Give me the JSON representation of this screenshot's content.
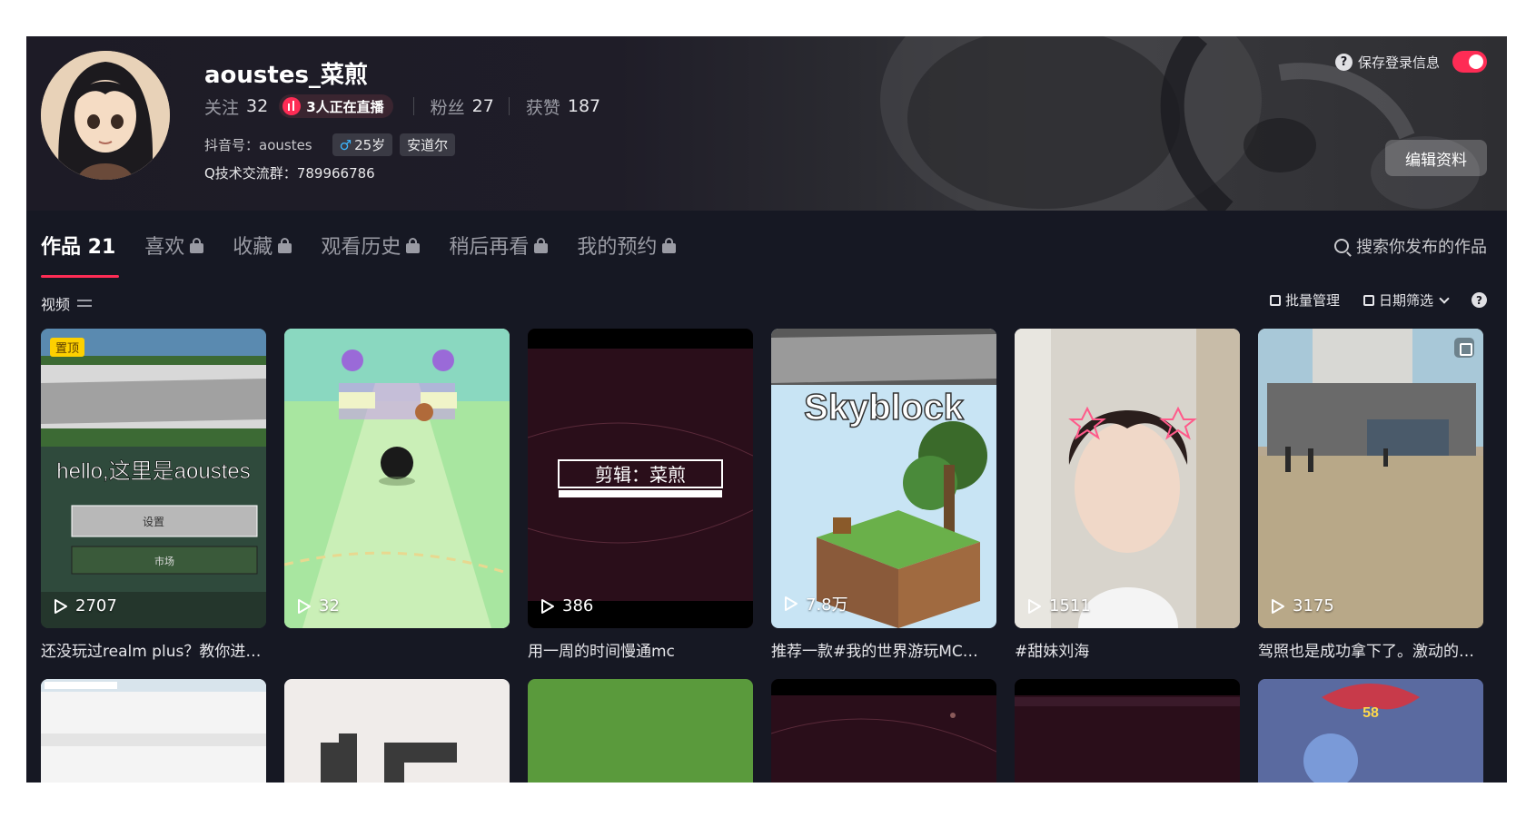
{
  "profile": {
    "username": "aoustes_菜煎",
    "following_label": "关注",
    "following": "32",
    "live_badge": "3人正在直播",
    "followers_label": "粉丝",
    "followers": "27",
    "likes_label": "获赞",
    "likes": "187",
    "douyin_id": "抖音号：aoustes",
    "gender_icon": "♂",
    "age": "25岁",
    "location": "安道尔",
    "qq_group": "Q技术交流群：789966786",
    "save_login": "保存登录信息",
    "edit_button": "编辑资料"
  },
  "tabs": [
    {
      "label": "作品 21",
      "locked": false
    },
    {
      "label": "喜欢",
      "locked": true
    },
    {
      "label": "收藏",
      "locked": true
    },
    {
      "label": "观看历史",
      "locked": true
    },
    {
      "label": "稍后再看",
      "locked": true
    },
    {
      "label": "我的预约",
      "locked": true
    }
  ],
  "search_placeholder": "搜索你发布的作品",
  "filter": {
    "section_label": "视频",
    "batch_manage": "批量管理",
    "date_filter": "日期筛选"
  },
  "videos": [
    {
      "plays": "2707",
      "caption": "还没玩过realm plus？教你进…",
      "pinned_label": "置顶",
      "thumb_text": "hello,这里是aoustes",
      "thumb_btn1": "设置",
      "thumb_btn2": "市场"
    },
    {
      "plays": "32",
      "caption": ""
    },
    {
      "plays": "386",
      "caption": "用一周的时间慢通mc",
      "thumb_text": "剪辑：菜煎"
    },
    {
      "plays": "7.8万",
      "caption": "推荐一款#我的世界游玩MC…",
      "thumb_text": "Skyblock"
    },
    {
      "plays": "1511",
      "caption": "#甜妹刘海"
    },
    {
      "plays": "3175",
      "caption": "驾照也是成功拿下了。激动的…"
    }
  ],
  "row2": {
    "badge_num": "58"
  },
  "colors": {
    "accent": "#fe2c55",
    "background": "#161823",
    "pin": "#fdd000"
  }
}
